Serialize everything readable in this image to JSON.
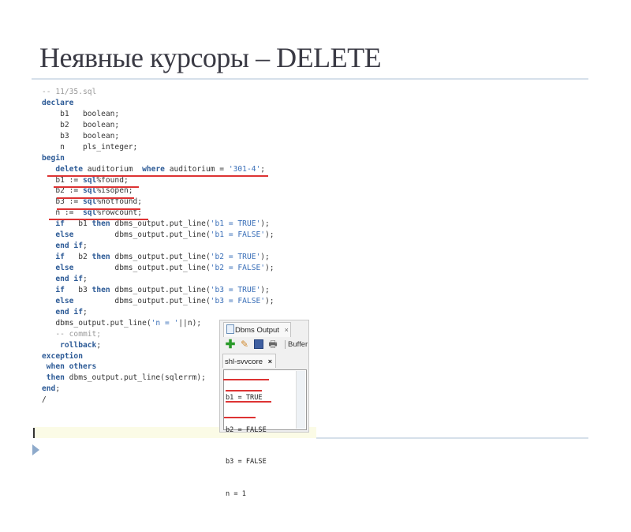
{
  "slide": {
    "title": "Неявные курсоры – DELETE"
  },
  "code": [
    [
      [
        "-- 11/35.sql",
        "cm"
      ]
    ],
    [
      [
        "declare",
        "kw"
      ]
    ],
    [
      [
        "    b1   boolean;",
        ""
      ]
    ],
    [
      [
        "    b2   boolean;",
        ""
      ]
    ],
    [
      [
        "    b3   boolean;",
        ""
      ]
    ],
    [
      [
        "    n    pls_integer;",
        ""
      ]
    ],
    [
      [
        "begin",
        "kw"
      ]
    ],
    [
      [
        "   ",
        ""
      ],
      [
        "delete",
        "kw"
      ],
      [
        " auditorium  ",
        ""
      ],
      [
        "where",
        "kw"
      ],
      [
        " auditorium = ",
        ""
      ],
      [
        "'301-4'",
        "str"
      ],
      [
        ";",
        ""
      ]
    ],
    [
      [
        "   b1 := ",
        ""
      ],
      [
        "sql",
        "kw"
      ],
      [
        "%found;",
        ""
      ]
    ],
    [
      [
        "   b2 := ",
        ""
      ],
      [
        "sql",
        "kw"
      ],
      [
        "%isopen;",
        ""
      ]
    ],
    [
      [
        "   b3 := ",
        ""
      ],
      [
        "sql",
        "kw"
      ],
      [
        "%notfound;",
        ""
      ]
    ],
    [
      [
        "   n :=  ",
        ""
      ],
      [
        "sql",
        "kw"
      ],
      [
        "%rowcount;",
        ""
      ]
    ],
    [
      [
        "   ",
        ""
      ],
      [
        "if",
        "kw"
      ],
      [
        "   b1 ",
        ""
      ],
      [
        "then",
        "kw"
      ],
      [
        " dbms_output.put_line(",
        ""
      ],
      [
        "'b1 = TRUE'",
        "str"
      ],
      [
        ");",
        ""
      ]
    ],
    [
      [
        "   ",
        ""
      ],
      [
        "else",
        "kw"
      ],
      [
        "         dbms_output.put_line(",
        ""
      ],
      [
        "'b1 = FALSE'",
        "str"
      ],
      [
        ");",
        ""
      ]
    ],
    [
      [
        "   ",
        ""
      ],
      [
        "end if",
        "kw"
      ],
      [
        ";",
        ""
      ]
    ],
    [
      [
        "   ",
        ""
      ],
      [
        "if",
        "kw"
      ],
      [
        "   b2 ",
        ""
      ],
      [
        "then",
        "kw"
      ],
      [
        " dbms_output.put_line(",
        ""
      ],
      [
        "'b2 = TRUE'",
        "str"
      ],
      [
        ");",
        ""
      ]
    ],
    [
      [
        "   ",
        ""
      ],
      [
        "else",
        "kw"
      ],
      [
        "         dbms_output.put_line(",
        ""
      ],
      [
        "'b2 = FALSE'",
        "str"
      ],
      [
        ");",
        ""
      ]
    ],
    [
      [
        "   ",
        ""
      ],
      [
        "end if",
        "kw"
      ],
      [
        ";",
        ""
      ]
    ],
    [
      [
        "   ",
        ""
      ],
      [
        "if",
        "kw"
      ],
      [
        "   b3 ",
        ""
      ],
      [
        "then",
        "kw"
      ],
      [
        " dbms_output.put_line(",
        ""
      ],
      [
        "'b3 = TRUE'",
        "str"
      ],
      [
        ");",
        ""
      ]
    ],
    [
      [
        "   ",
        ""
      ],
      [
        "else",
        "kw"
      ],
      [
        "         dbms_output.put_line(",
        ""
      ],
      [
        "'b3 = FALSE'",
        "str"
      ],
      [
        ");",
        ""
      ]
    ],
    [
      [
        "   ",
        ""
      ],
      [
        "end if",
        "kw"
      ],
      [
        ";",
        ""
      ]
    ],
    [
      [
        "   dbms_output.put_line(",
        ""
      ],
      [
        "'n = '",
        "str"
      ],
      [
        "||n);",
        ""
      ]
    ],
    [
      [
        "   ",
        ""
      ],
      [
        "-- commit;",
        "cm"
      ]
    ],
    [
      [
        "    ",
        ""
      ],
      [
        "rollback",
        "kw"
      ],
      [
        ";",
        ""
      ]
    ],
    [
      [
        "exception",
        "kw"
      ]
    ],
    [
      [
        " ",
        ""
      ],
      [
        "when others",
        "kw"
      ]
    ],
    [
      [
        " ",
        ""
      ],
      [
        "then",
        "kw"
      ],
      [
        " dbms_output.put_line(sqlerrm);",
        ""
      ]
    ],
    [
      [
        "end",
        "kw"
      ],
      [
        ";",
        ""
      ]
    ],
    [
      [
        "/",
        ""
      ]
    ]
  ],
  "output_panel": {
    "tab_label": "Dbms Output",
    "tab_close": "×",
    "buffer_label": "Buffer",
    "connection_tab": "shl-svvcore",
    "connection_close": "×",
    "lines": [
      "b1 = TRUE",
      "b2 = FALSE",
      "b3 = FALSE",
      "n = 1"
    ]
  },
  "colors": {
    "keyword": "#2c5a96",
    "string": "#3a6fb8",
    "underline": "#dd3333"
  }
}
